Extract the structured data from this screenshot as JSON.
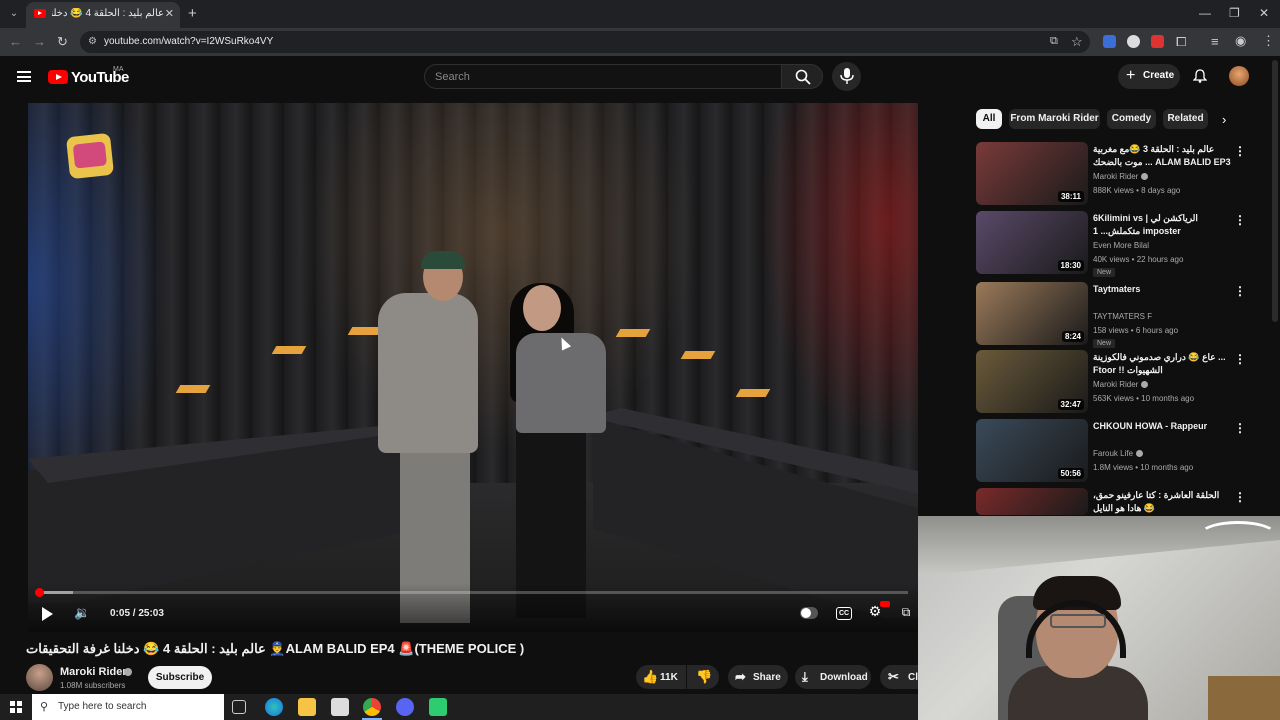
{
  "browser": {
    "tab_title": "عالم بليد : الحلقة 4 😂 دخلنا",
    "url": "youtube.com/watch?v=I2WSuRko4VY"
  },
  "youtube": {
    "logo_text": "YouTube",
    "country": "MA",
    "search_placeholder": "Search",
    "create_label": "Create"
  },
  "player": {
    "time": "0:05 / 25:03",
    "progress_fraction": 0.0002,
    "buffered_fraction": 0.04
  },
  "video": {
    "title": "عالم بليد : الحلقة 4 😂 دخلنا غرفة التحقيقات 👮‍♂️ALAM BALID EP4 🚨(THEME POLICE )",
    "channel": "Maroki Rider",
    "subscribers": "1.08M subscribers",
    "subscribe_label": "Subscribe",
    "likes": "11K",
    "share_label": "Share",
    "download_label": "Download",
    "clip_label": "Cl"
  },
  "chips": [
    "All",
    "From Maroki Rider",
    "Comedy",
    "Related"
  ],
  "recommendations": [
    {
      "title": "عالم بليد : الحلقة 3 😂مع مغربية موت بالضحك ... ALAM BALID EP3",
      "channel": "Maroki Rider",
      "verified": true,
      "meta": "888K views • 8 days ago",
      "duration": "38:11",
      "badge": "",
      "thumb_color": "#7a3a3a"
    },
    {
      "title": "6Kilimini vs | الرياكشن لي متكملش... 1 imposter",
      "channel": "Even More Bilal",
      "verified": false,
      "meta": "40K views • 22 hours ago",
      "duration": "18:30",
      "badge": "New",
      "thumb_color": "#5a4a6a"
    },
    {
      "title": "Taytmaters",
      "channel": "TAYTMATERS F",
      "verified": false,
      "meta": "158 views • 6 hours ago",
      "duration": "8:24",
      "badge": "New",
      "thumb_color": "#9a7a5a"
    },
    {
      "title": "عاع 😂 دراري صدموني فالكوزينة ... Ftoor !! الشهيوات",
      "channel": "Maroki Rider",
      "verified": true,
      "meta": "563K views • 10 months ago",
      "duration": "32:47",
      "badge": "",
      "thumb_color": "#6a5a3a"
    },
    {
      "title": "CHKOUN HOWA - Rappeur",
      "channel": "Farouk Life",
      "verified": true,
      "meta": "1.8M views • 10 months ago",
      "duration": "50:56",
      "badge": "",
      "thumb_color": "#3a4a5a"
    },
    {
      "title": "الحلقة العاشرة : كتا عارفينو حمق، هادا هو النايل 😂 Nouamaneelabiarii@ 😎",
      "channel": "",
      "verified": false,
      "meta": "",
      "duration": "",
      "badge": "",
      "thumb_color": "#7a2a2a"
    }
  ],
  "taskbar": {
    "search_placeholder": "Type here to search"
  }
}
